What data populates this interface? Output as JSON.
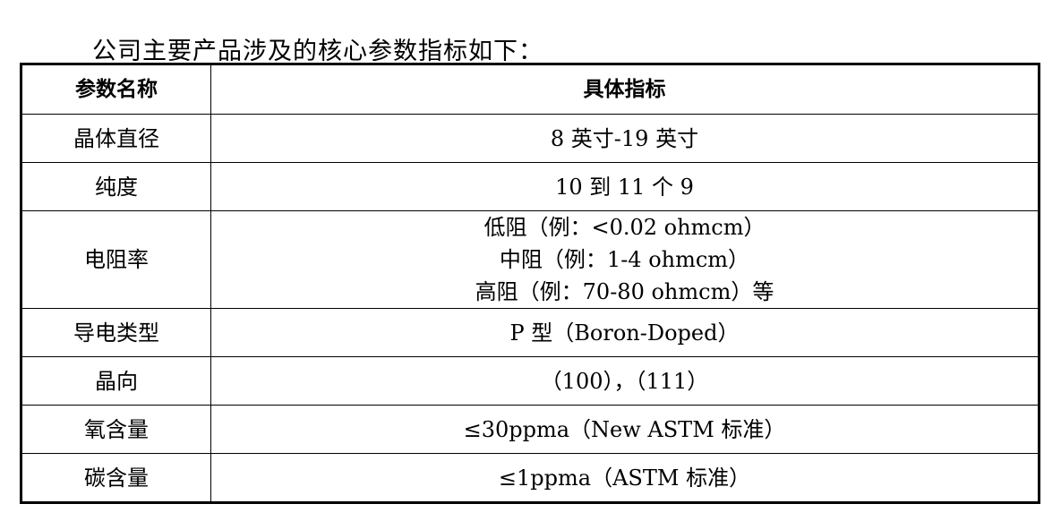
{
  "intro": "公司主要产品涉及的核心参数指标如下：",
  "table": {
    "headers": [
      "参数名称",
      "具体指标"
    ],
    "rows": [
      {
        "name": "晶体直径",
        "value": [
          "8 英寸-19 英寸"
        ]
      },
      {
        "name": "纯度",
        "value": [
          "10 到 11 个 9"
        ]
      },
      {
        "name": "电阻率",
        "value": [
          "低阻（例：<0.02 ohmcm）",
          "中阻（例：1-4 ohmcm）",
          "高阻（例：70-80 ohmcm）等"
        ]
      },
      {
        "name": "导电类型",
        "value": [
          "P 型（Boron-Doped）"
        ]
      },
      {
        "name": "晶向",
        "value": [
          "（100），（111）"
        ]
      },
      {
        "name": "氧含量",
        "value": [
          "≤30ppma（New ASTM 标准）"
        ]
      },
      {
        "name": "碳含量",
        "value": [
          "≤1ppma（ASTM 标准）"
        ]
      }
    ]
  }
}
